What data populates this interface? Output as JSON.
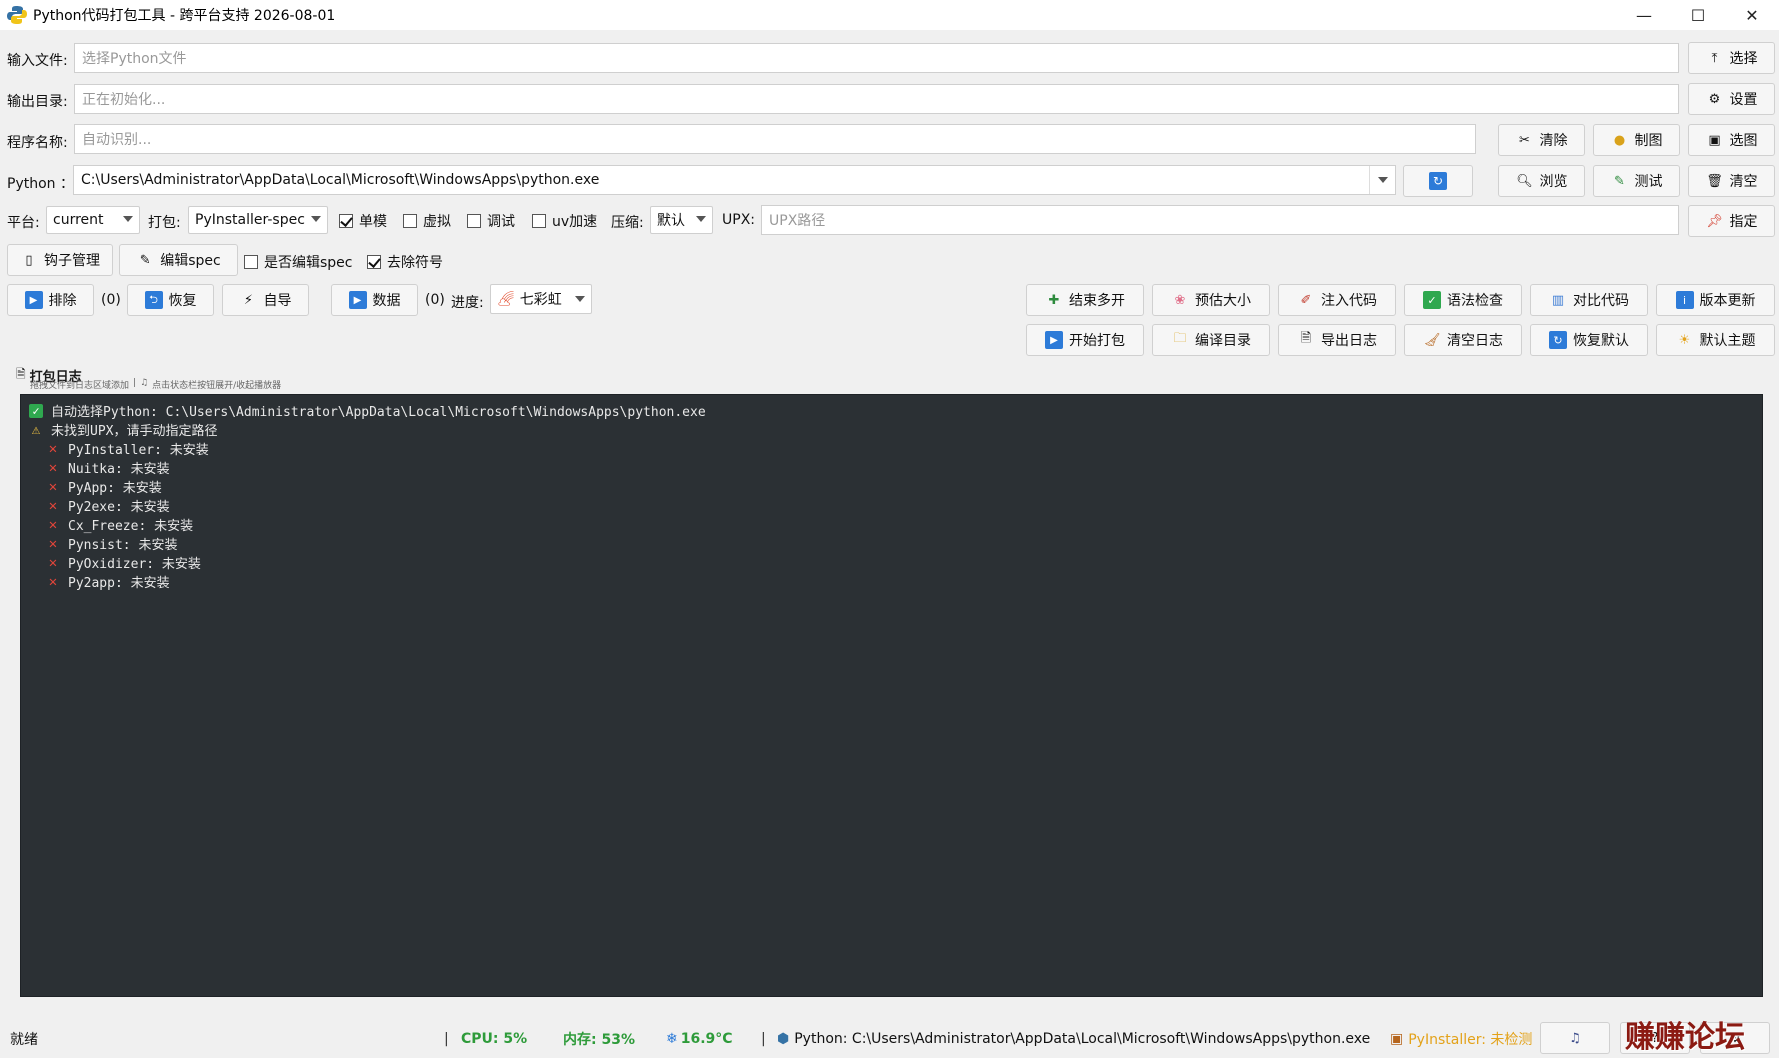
{
  "window": {
    "title": "Python代码打包工具 - 跨平台支持 2026-08-01",
    "minimize": "—",
    "maximize": "☐",
    "close": "✕"
  },
  "input_file": {
    "label": "输入文件:",
    "placeholder": "选择Python文件",
    "button": "选择"
  },
  "output_dir": {
    "label": "输出目录:",
    "placeholder": "正在初始化...",
    "button": "设置"
  },
  "program_name": {
    "label": "程序名称:",
    "placeholder": "自动识别...",
    "btn_clear": "清除",
    "btn_draw": "制图",
    "btn_pick": "选图"
  },
  "python": {
    "label": "Python ：",
    "path": "C:\\Users\\Administrator\\AppData\\Local\\Microsoft\\WindowsApps\\python.exe",
    "btn_browse": "浏览",
    "btn_test": "测试",
    "btn_empty": "清空"
  },
  "options": {
    "platform_label": "平台:",
    "platform_value": "current",
    "pack_label": "打包:",
    "pack_value": "PyInstaller-spec",
    "single": "单模",
    "virtual": "虚拟",
    "debug": "调试",
    "uv": "uv加速",
    "compress_label": "压缩:",
    "compress_value": "默认",
    "upx_label": "UPX:",
    "upx_placeholder": "UPX路径",
    "btn_assign": "指定"
  },
  "row5": {
    "hook_mgr": "钩子管理",
    "edit_spec": "编辑spec",
    "edit_spec_chk": "是否编辑spec",
    "strip_chk": "去除符号"
  },
  "row6": {
    "exclude": "排除",
    "exclude_count": "(0)",
    "restore": "恢复",
    "autoimport": "自导",
    "data": "数据",
    "data_count": "(0)",
    "progress_label": "进度:",
    "progress_value": "七彩虹",
    "end_multi": "结束多开",
    "estimate": "预估大小",
    "inject": "注入代码",
    "syntax": "语法检查",
    "compare": "对比代码",
    "update": "版本更新"
  },
  "row7": {
    "start": "开始打包",
    "compile_dir": "编译目录",
    "export_log": "导出日志",
    "clear_log": "清空日志",
    "reset": "恢复默认",
    "default_theme": "默认主题"
  },
  "log": {
    "title": "打包日志",
    "hint1": "拖拽文件到日志区域添加",
    "hint2": "点击状态栏按钮展开/收起播放器",
    "lines": [
      {
        "kind": "ok",
        "text": "自动选择Python: C:\\Users\\Administrator\\AppData\\Local\\Microsoft\\WindowsApps\\python.exe"
      },
      {
        "kind": "warn",
        "text": "未找到UPX，请手动指定路径"
      },
      {
        "kind": "x",
        "text": "PyInstaller: 未安装"
      },
      {
        "kind": "x",
        "text": "Nuitka: 未安装"
      },
      {
        "kind": "x",
        "text": "PyApp: 未安装"
      },
      {
        "kind": "x",
        "text": "Py2exe: 未安装"
      },
      {
        "kind": "x",
        "text": "Cx_Freeze: 未安装"
      },
      {
        "kind": "x",
        "text": "Pynsist: 未安装"
      },
      {
        "kind": "x",
        "text": "PyOxidizer: 未安装"
      },
      {
        "kind": "x",
        "text": "Py2app: 未安装"
      }
    ]
  },
  "status": {
    "ready": "就绪",
    "cpu": "CPU: 5%",
    "mem": "内存: 53%",
    "temp": "16.9°C",
    "python": "Python: C:\\Users\\Administrator\\AppData\\Local\\Microsoft\\WindowsApps\\python.exe",
    "pyinstaller": "PyInstaller: 未检测",
    "watermark": "赚赚论坛",
    "colors": {
      "green": "#2e9b3a",
      "orange": "#e3a21a",
      "watermark": "#8b1a12"
    }
  }
}
